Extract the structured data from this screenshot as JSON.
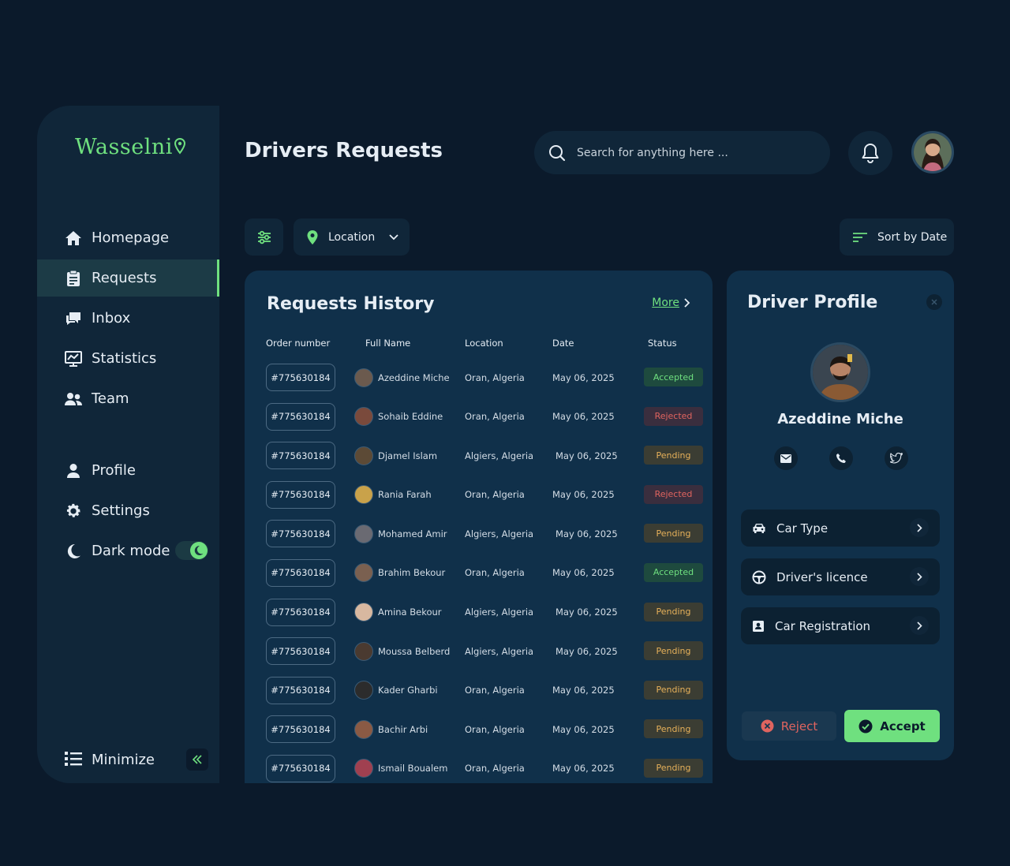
{
  "brand": {
    "name": "Wasselni"
  },
  "colors": {
    "accent": "#6fe07f",
    "background": "#0b1a2b",
    "panel": "#10304a",
    "rejected": "#e0645f",
    "pending": "#e7b15a"
  },
  "sidebar": {
    "items": [
      {
        "label": "Homepage",
        "icon": "home-icon"
      },
      {
        "label": "Requests",
        "icon": "clipboard-icon",
        "active": true
      },
      {
        "label": "Inbox",
        "icon": "chat-icon"
      },
      {
        "label": "Statistics",
        "icon": "chart-icon"
      },
      {
        "label": "Team",
        "icon": "team-icon"
      }
    ],
    "bottom_items": [
      {
        "label": "Profile",
        "icon": "user-icon"
      },
      {
        "label": "Settings",
        "icon": "gear-icon"
      },
      {
        "label": "Dark mode",
        "icon": "moon-icon"
      }
    ],
    "dark_mode_on": true,
    "minimize_label": "Minimize"
  },
  "header": {
    "title": "Drivers Requests",
    "search_placeholder": "Search for anything here ..."
  },
  "toolbar": {
    "location_label": "Location",
    "sort_label": "Sort by Date"
  },
  "requests": {
    "title": "Requests History",
    "more_label": "More",
    "columns": [
      "Order number",
      "Full Name",
      "Location",
      "Date",
      "Status"
    ],
    "rows": [
      {
        "order": "#775630184",
        "name": "Azeddine Miche",
        "location": "Oran, Algeria",
        "date": "May 06, 2025",
        "status": "Accepted"
      },
      {
        "order": "#775630184",
        "name": "Sohaib Eddine",
        "location": "Oran, Algeria",
        "date": "May 06, 2025",
        "status": "Rejected"
      },
      {
        "order": "#775630184",
        "name": "Djamel Islam",
        "location": "Algiers, Algeria",
        "date": "May 06, 2025",
        "status": "Pending"
      },
      {
        "order": "#775630184",
        "name": "Rania Farah",
        "location": "Oran, Algeria",
        "date": "May 06, 2025",
        "status": "Rejected"
      },
      {
        "order": "#775630184",
        "name": "Mohamed Amir",
        "location": "Algiers, Algeria",
        "date": "May 06, 2025",
        "status": "Pending"
      },
      {
        "order": "#775630184",
        "name": "Brahim Bekour",
        "location": "Oran, Algeria",
        "date": "May 06, 2025",
        "status": "Accepted"
      },
      {
        "order": "#775630184",
        "name": "Amina Bekour",
        "location": "Algiers, Algeria",
        "date": "May 06, 2025",
        "status": "Pending"
      },
      {
        "order": "#775630184",
        "name": "Moussa Belberd",
        "location": "Algiers, Algeria",
        "date": "May 06, 2025",
        "status": "Pending"
      },
      {
        "order": "#775630184",
        "name": "Kader Gharbi",
        "location": "Oran, Algeria",
        "date": "May 06, 2025",
        "status": "Pending"
      },
      {
        "order": "#775630184",
        "name": "Bachir Arbi",
        "location": "Oran, Algeria",
        "date": "May 06, 2025",
        "status": "Pending"
      },
      {
        "order": "#775630184",
        "name": "Ismail Boualem",
        "location": "Oran, Algeria",
        "date": "May 06, 2025",
        "status": "Pending"
      }
    ]
  },
  "profile": {
    "title": "Driver Profile",
    "name": "Azeddine Miche",
    "contact_icons": [
      "mail-icon",
      "phone-icon",
      "twitter-icon"
    ],
    "documents": [
      {
        "label": "Car Type",
        "icon": "car-icon"
      },
      {
        "label": "Driver's licence",
        "icon": "steering-wheel-icon"
      },
      {
        "label": "Car Registration",
        "icon": "id-card-icon"
      }
    ],
    "reject_label": "Reject",
    "accept_label": "Accept"
  }
}
